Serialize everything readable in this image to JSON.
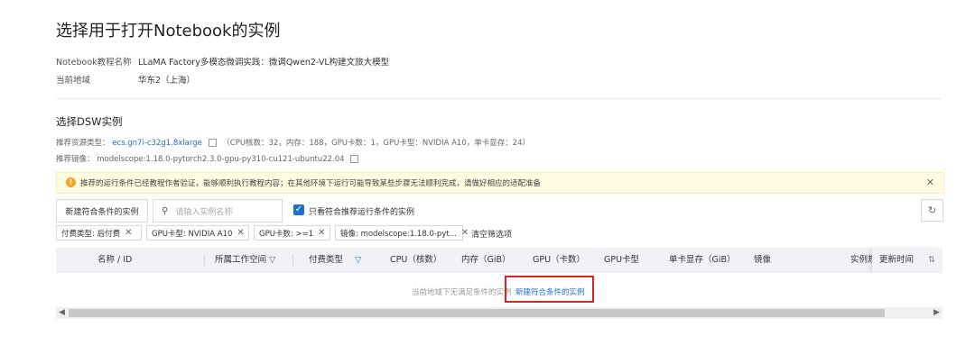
{
  "page": {
    "title": "选择用于打开Notebook的实例"
  },
  "info": {
    "tutorial_label": "Notebook教程名称",
    "tutorial_value": "LLaMA Factory多模态微调实践：微调Qwen2-VL构建文旅大模型",
    "region_label": "当前地域",
    "region_value": "华东2（上海）"
  },
  "dsw": {
    "section_title": "选择DSW实例",
    "resource_label": "推荐资源类型：",
    "resource_type": "ecs.gn7i-c32g1.8xlarge",
    "resource_spec": "（CPU核数：32，内存：188，GPU卡数：1，GPU卡型：NVIDIA A10，单卡显存：24）",
    "image_label": "推荐镜像：",
    "image_value": "modelscope:1.18.0-pytorch2.3.0-gpu-py310-cu121-ubuntu22.04"
  },
  "banner": {
    "text": "推荐的运行条件已经教程作者验证，能够顺利执行教程内容；在其他环境下运行可能导致某些步骤无法顺利完成，请做好相应的适配准备",
    "close": "✕"
  },
  "toolbar": {
    "new_button": "新建符合条件的实例",
    "search_placeholder": "请输入实例名称",
    "checkbox_label": "只看符合推荐运行条件的实例",
    "refresh_icon": "↻"
  },
  "filters": {
    "tags": [
      "付费类型: 后付费",
      "GPU卡型: NVIDIA A10",
      "GPU卡数: >=1",
      "镜像: modelscope:1.18.0-pyt..."
    ],
    "clear": "清空筛选项"
  },
  "table": {
    "columns": [
      "名称 / ID",
      "所属工作空间",
      "付费类型",
      "CPU（核数）",
      "内存（GiB）",
      "GPU（卡数）",
      "GPU卡型",
      "单卡显存（GiB）",
      "镜像",
      "实例规",
      "更新时间"
    ],
    "empty_text": "当前地域下无满足条件的实例",
    "empty_link": "新建符合条件的实例"
  },
  "colors": {
    "accent": "#1f6fd1",
    "highlight": "#e02020",
    "warning": "#f5a623"
  }
}
